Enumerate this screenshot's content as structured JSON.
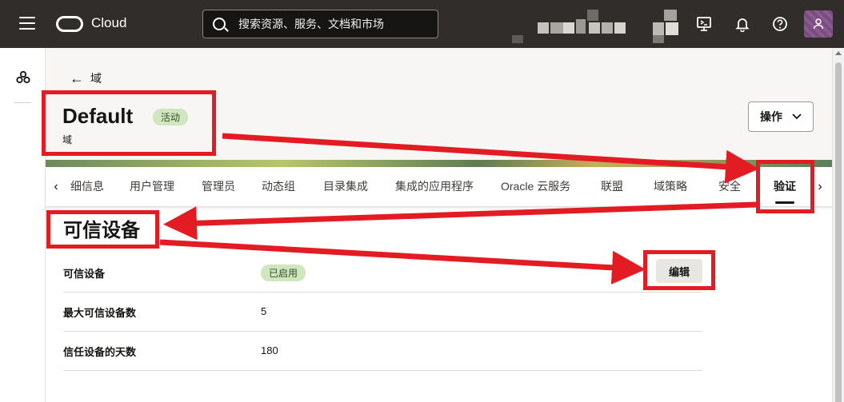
{
  "topbar": {
    "brand": "Cloud",
    "search_placeholder": "搜索资源、服务、文档和市场",
    "icons": [
      "menu-icon",
      "oracle-logo-icon",
      "search-icon",
      "cloud-shell-icon",
      "bell-icon",
      "help-icon",
      "profile-icon"
    ]
  },
  "header": {
    "back_label": "域",
    "title": "Default",
    "status": "活动",
    "subtitle": "域",
    "actions_label": "操作"
  },
  "tabs": [
    {
      "label": "细信息"
    },
    {
      "label": "用户管理"
    },
    {
      "label": "管理员"
    },
    {
      "label": "动态组"
    },
    {
      "label": "目录集成"
    },
    {
      "label": "集成的应用程序"
    },
    {
      "label": "Oracle 云服务"
    },
    {
      "label": "联盟"
    },
    {
      "label": "域策略"
    },
    {
      "label": "安全"
    },
    {
      "label": "验证"
    }
  ],
  "active_tab": "验证",
  "section": {
    "title": "可信设备",
    "edit_label": "编辑",
    "rows": [
      {
        "label": "可信设备",
        "value": "已启用"
      },
      {
        "label": "最大可信设备数",
        "value": "5"
      },
      {
        "label": "信任设备的天数",
        "value": "180"
      }
    ]
  },
  "colors": {
    "topbar": "#312d2a",
    "badge_bg": "#cfe6bf",
    "annotation_red": "#e31b23"
  }
}
